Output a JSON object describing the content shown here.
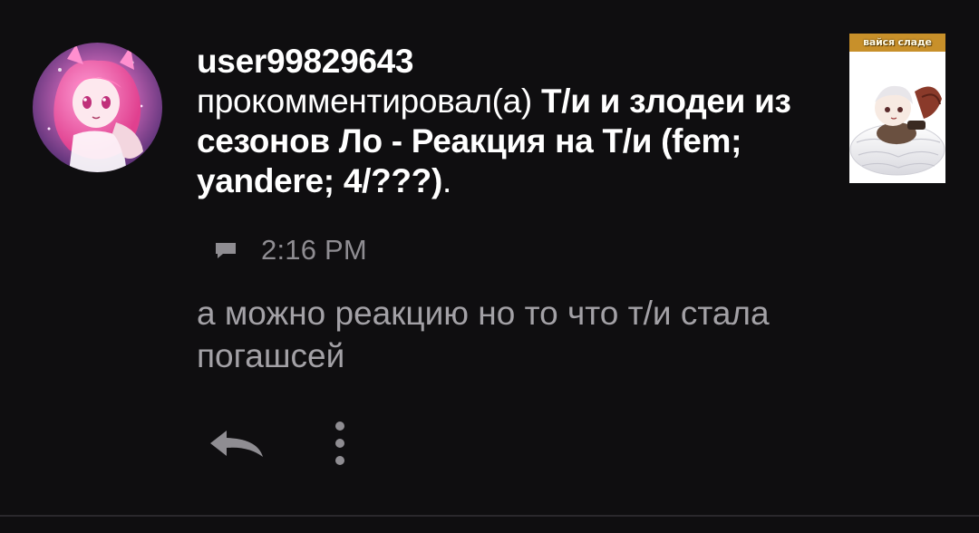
{
  "notification": {
    "username": "user99829643",
    "action": "прокомментировал(а) ",
    "story_title": "Т/и и злодеи из сезонов Ло - Реакция на Т/и (fem; yandere; 4/???)",
    "trailing": ".",
    "thumbnail_caption": "вайся сладе",
    "timestamp": "2:16 PM",
    "comment": "а можно реакцию но то что т/и стала погашсей"
  },
  "icons": {
    "avatar": "anime-girl-avatar",
    "thumbnail": "story-cover-thumbnail",
    "comment": "comment-icon",
    "reply": "reply-arrow-icon",
    "more": "vertical-dots-icon"
  },
  "colors": {
    "background": "#0f0e10",
    "primary_text": "#ffffff",
    "secondary_text": "#a3a1a6",
    "meta_text": "#8f8d92"
  }
}
